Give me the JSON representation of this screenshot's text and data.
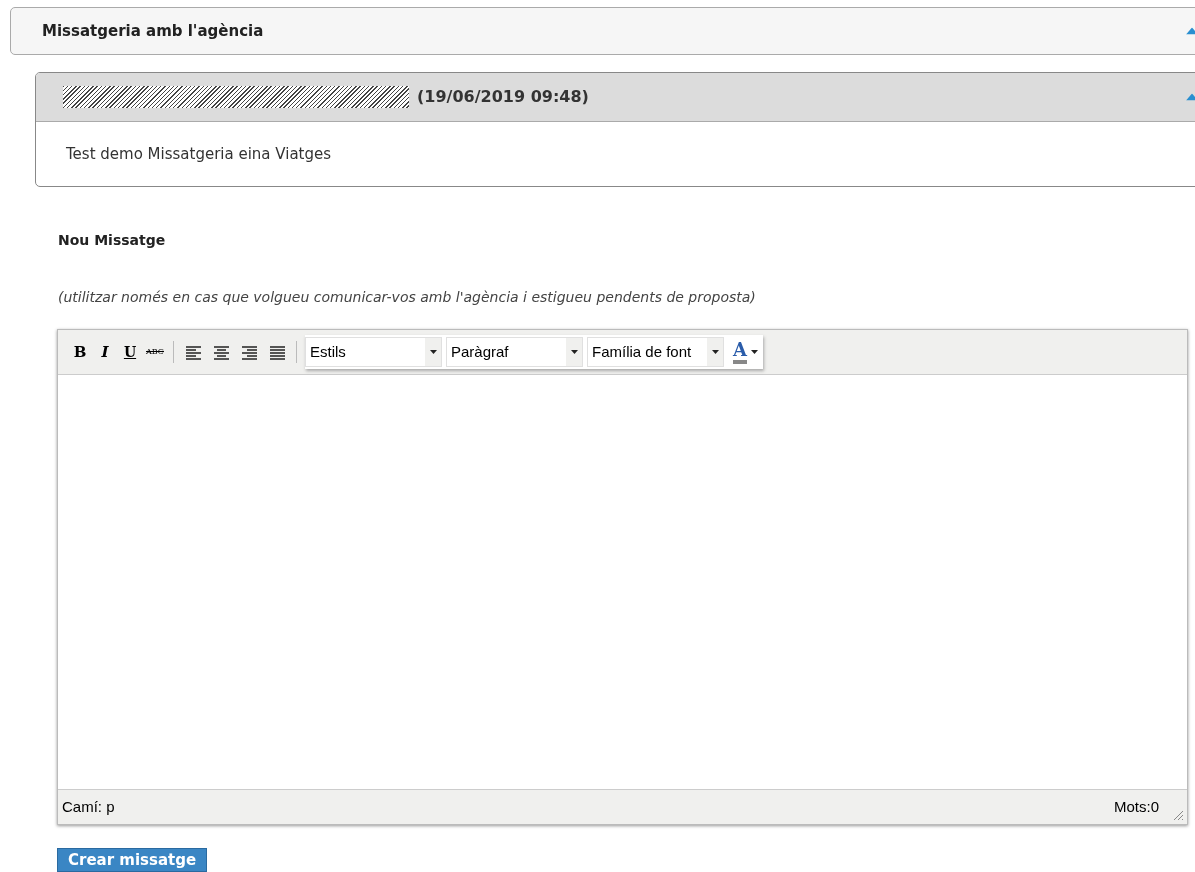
{
  "panel": {
    "title": "Missatgeria amb l'agència",
    "expanded": true
  },
  "messages": [
    {
      "date": "(19/06/2019 09:48)",
      "body": "Test demo Missatgeria eina Viatges",
      "expanded": true
    }
  ],
  "new_message": {
    "heading": "Nou Missatge",
    "note": "(utilitzar només en cas que volgueu comunicar-vos amb l'agència i estigueu pendents de proposta)"
  },
  "editor": {
    "toolbar": [
      {
        "kind": "bold",
        "label": "B"
      },
      {
        "kind": "italic",
        "label": "I"
      },
      {
        "kind": "underline",
        "label": "U"
      },
      {
        "kind": "strikethrough",
        "label": "ABC"
      },
      {
        "kind": "separator"
      },
      {
        "kind": "alignleft"
      },
      {
        "kind": "aligncenter"
      },
      {
        "kind": "alignright"
      },
      {
        "kind": "justify"
      },
      {
        "kind": "separator"
      },
      {
        "kind": "dropdown",
        "value": "Estils"
      },
      {
        "kind": "dropdown",
        "value": "Paràgraf"
      },
      {
        "kind": "dropdown",
        "value": "Família de font"
      },
      {
        "kind": "color",
        "label": "A"
      }
    ],
    "path": "Camí: p",
    "word_count": "Mots:0"
  },
  "submit_button": "Crear missatge"
}
